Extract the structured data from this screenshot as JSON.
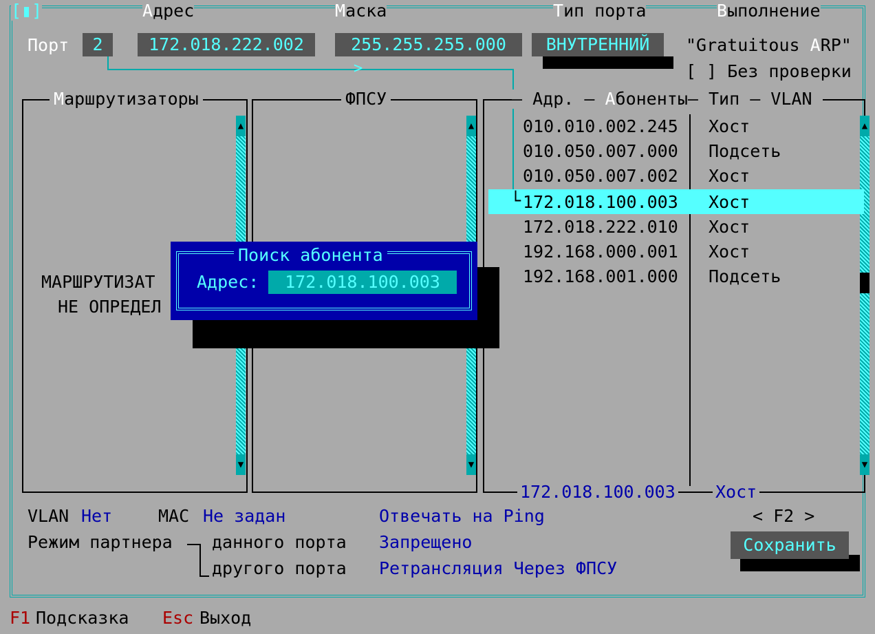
{
  "header": {
    "window_control": "[▮]",
    "address_label": "Адрес",
    "mask_label": "Маска",
    "port_type_label": "Тип порта",
    "execution_label": "Выполнение"
  },
  "port": {
    "label": "Порт",
    "number": "2",
    "address": "172.018.222.002",
    "mask": "255.255.255.000",
    "type": "ВНУТРЕННИЙ"
  },
  "execution": {
    "gratuitous_arp": "\"Gratuitous ARP\"",
    "no_check": "[ ] Без проверки"
  },
  "panels": {
    "routers_title": "Маршрутизаторы",
    "routers_empty_line1": "МАРШРУТИЗАТ",
    "routers_empty_line2": "НЕ ОПРЕДЕЛ",
    "fpsu_title": "ФПСУ",
    "subscribers_title": "— Адр. — Абоненты— Тип — VLAN"
  },
  "subscribers": [
    {
      "address": "010.010.002.245",
      "type": "Хост"
    },
    {
      "address": "010.050.007.000",
      "type": "Подсеть"
    },
    {
      "address": "010.050.007.002",
      "type": "Хост"
    },
    {
      "address": "172.018.100.003",
      "type": "Хост",
      "selected": true
    },
    {
      "address": "172.018.222.010",
      "type": "Хост"
    },
    {
      "address": "192.168.000.001",
      "type": "Хост"
    },
    {
      "address": "192.168.001.000",
      "type": "Подсеть"
    }
  ],
  "current": {
    "address": "172.018.100.003",
    "type": "Хост"
  },
  "search_dialog": {
    "title": "Поиск абонента",
    "address_label": "Адрес:",
    "address_value": "172.018.100.003"
  },
  "info": {
    "vlan_label": "VLAN",
    "vlan_value": "Нет",
    "mac_label": "MAC",
    "mac_value": "Не задан",
    "ping_label": "Отвечать на Ping",
    "partner_mode_label": "Режим партнера",
    "this_port_label": "данного порта",
    "this_port_value": "Запрещено",
    "other_port_label": "другого порта",
    "other_port_value": "Ретрансляция Через ФПСУ"
  },
  "save": {
    "hotkey": "< F2 >",
    "label": "Сохранить"
  },
  "statusbar": {
    "f1_key": "F1",
    "f1_label": "Подсказка",
    "esc_key": "Esc",
    "esc_label": "Выход"
  },
  "colors": {
    "background": "#aaaaaa",
    "accent_cyan": "#55ffff",
    "dark_cyan": "#00aaaa",
    "dialog_blue": "#0000aa",
    "field_gray": "#555555",
    "hotkey_red": "#aa0000"
  }
}
